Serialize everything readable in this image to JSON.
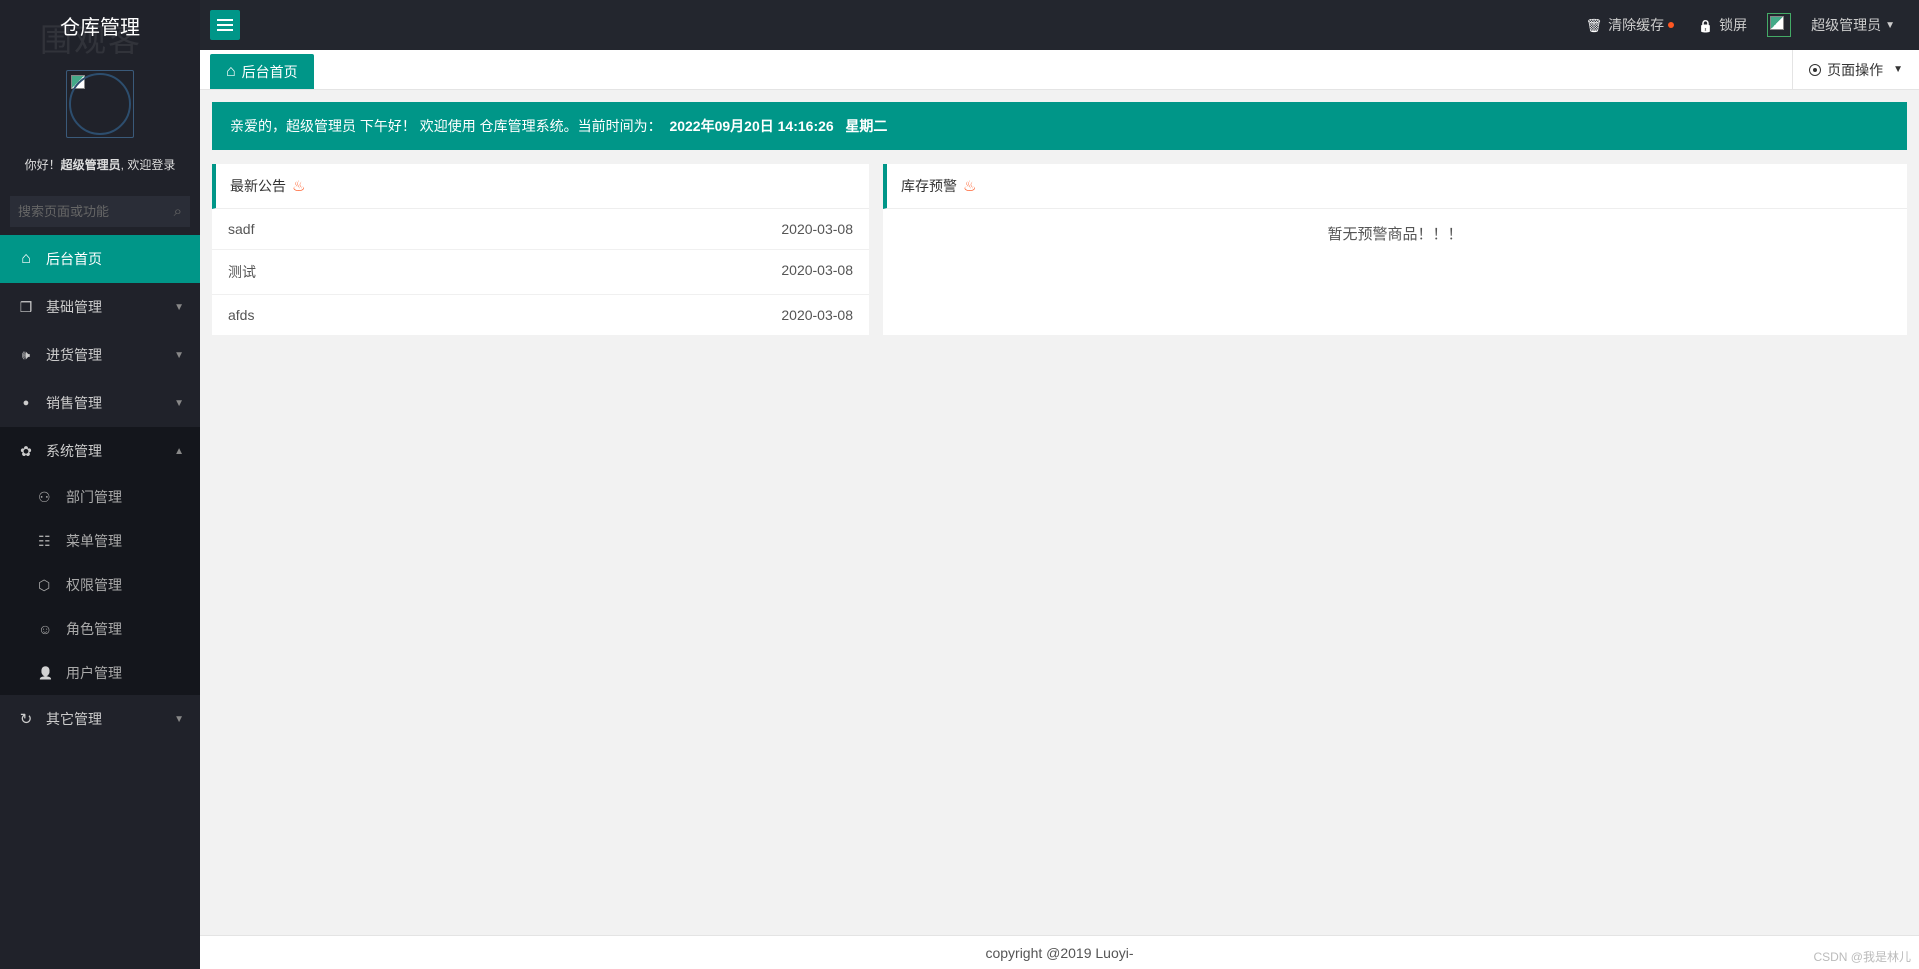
{
  "app_title": "仓库管理",
  "watermark": "围观客",
  "welcome_prefix": "你好！",
  "welcome_user": "超级管理员",
  "welcome_suffix": ", 欢迎登录",
  "search_placeholder": "搜索页面或功能",
  "nav": {
    "home": "后台首页",
    "basic": "基础管理",
    "purchase": "进货管理",
    "sales": "销售管理",
    "system": "系统管理",
    "other": "其它管理"
  },
  "system_sub": {
    "dept": "部门管理",
    "menu": "菜单管理",
    "perm": "权限管理",
    "role": "角色管理",
    "user": "用户管理"
  },
  "topbar": {
    "clear_cache": "清除缓存",
    "lock": "锁屏",
    "username": "超级管理员"
  },
  "tabs": {
    "home": "后台首页",
    "page_ops": "页面操作"
  },
  "banner": {
    "greeting_prefix": "亲爱的，",
    "greeting_user": "超级管理员",
    "greeting_time": " 下午好！",
    "welcome_text": " 欢迎使用 仓库管理系统。当前时间为：",
    "datetime": "2022年09月20日 14:16:26",
    "weekday": "星期二"
  },
  "panels": {
    "announce_title": "最新公告",
    "stock_title": "库存预警",
    "stock_empty": "暂无预警商品！！！"
  },
  "announcements": [
    {
      "title": "sadf",
      "date": "2020-03-08"
    },
    {
      "title": "测试",
      "date": "2020-03-08"
    },
    {
      "title": "afds",
      "date": "2020-03-08"
    }
  ],
  "footer": "copyright @2019 Luoyi-",
  "csdn": "CSDN @我是林儿"
}
